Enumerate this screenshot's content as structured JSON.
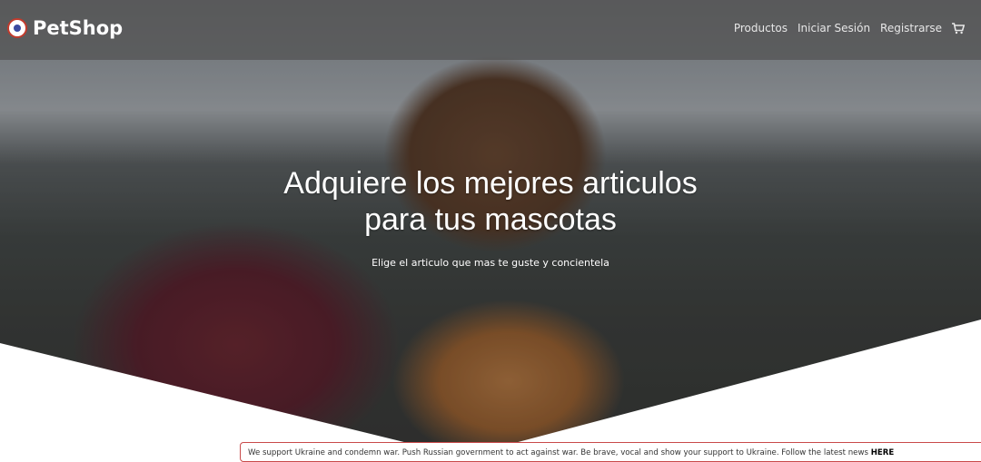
{
  "brand": {
    "name": "PetShop"
  },
  "nav": {
    "items": [
      "Productos",
      "Iniciar Sesión",
      "Registrarse"
    ],
    "cart_icon": "shopping-cart-icon"
  },
  "hero": {
    "title_line1": "Adquiere los mejores articulos",
    "title_line2": "para tus mascotas",
    "subtitle": "Elige el articulo que mas te guste y concientela"
  },
  "banner": {
    "text": "We support Ukraine and condemn war. Push Russian government to act against war. Be brave, vocal and show your support to Ukraine. Follow the latest news ",
    "link": "HERE"
  },
  "colors": {
    "banner_border": "#c94a4a",
    "navbar_bg": "#525252"
  }
}
